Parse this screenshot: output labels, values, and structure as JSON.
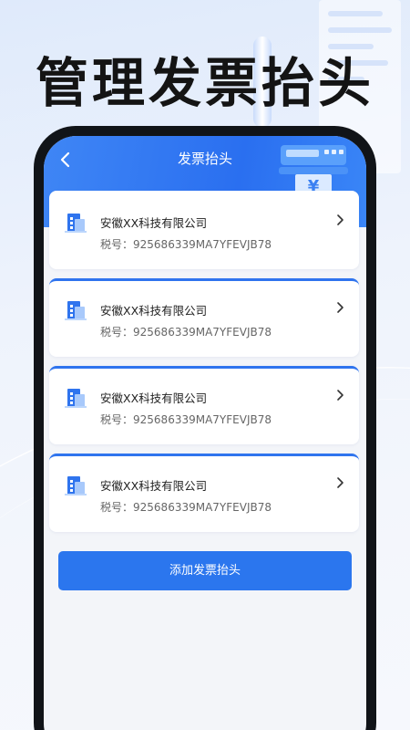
{
  "headline": "管理发票抬头",
  "nav": {
    "title": "发票抬头"
  },
  "invoice_headers": [
    {
      "company": "安徽XX科技有限公司",
      "tax_label": "税号：",
      "tax_id": "925686339MA7YFEVJB78"
    },
    {
      "company": "安徽XX科技有限公司",
      "tax_label": "税号：",
      "tax_id": "925686339MA7YFEVJB78"
    },
    {
      "company": "安徽XX科技有限公司",
      "tax_label": "税号：",
      "tax_id": "925686339MA7YFEVJB78"
    },
    {
      "company": "安徽XX科技有限公司",
      "tax_label": "税号：",
      "tax_id": "925686339MA7YFEVJB78"
    }
  ],
  "add_button": "添加发票抬头",
  "decor": {
    "register_symbol": "¥"
  },
  "colors": {
    "primary": "#2b76ee",
    "header_gradient_start": "#3f86f5",
    "phone_frame": "#111418"
  }
}
